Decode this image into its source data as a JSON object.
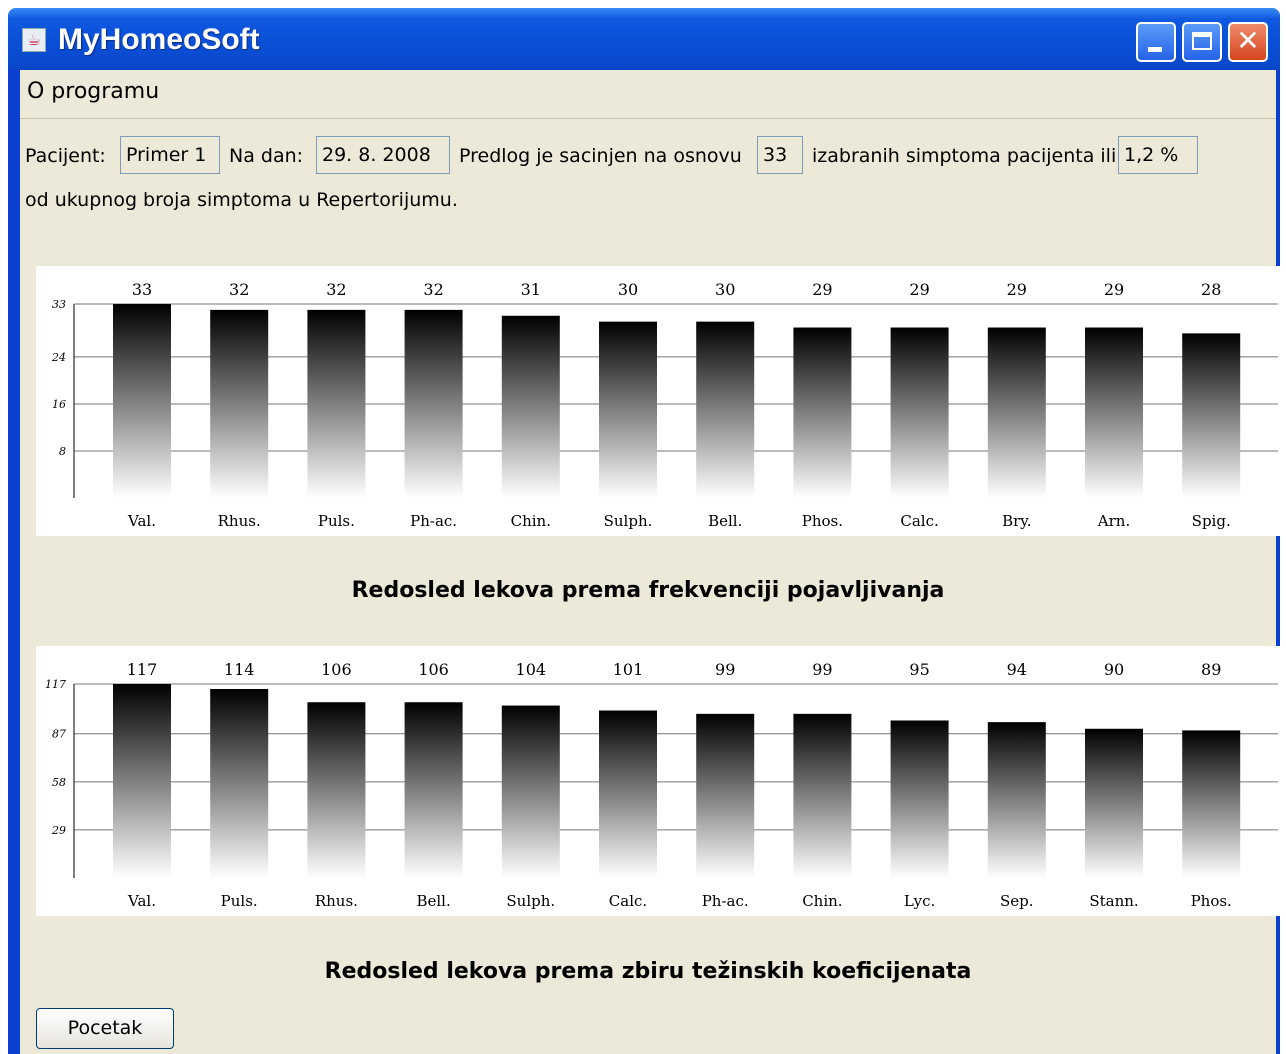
{
  "window": {
    "title": "MyHomeoSoft"
  },
  "menu": {
    "about": "O programu"
  },
  "info": {
    "patient_label": "Pacijent:",
    "patient_value": "Primer 1",
    "date_label": "Na dan:",
    "date_value": "29. 8. 2008",
    "basis_label": "Predlog je sacinjen na osnovu",
    "count_value": "33",
    "selected_label": "izabranih simptoma pacijenta ili",
    "percent_value": "1,2 %",
    "line2": "od ukupnog broja simptoma u Repertorijumu."
  },
  "buttons": {
    "start": "Pocetak"
  },
  "chart_data": [
    {
      "type": "bar",
      "title": "Redosled lekova prema frekvenciji pojavljivanja",
      "categories": [
        "Val.",
        "Rhus.",
        "Puls.",
        "Ph-ac.",
        "Chin.",
        "Sulph.",
        "Bell.",
        "Phos.",
        "Calc.",
        "Bry.",
        "Arn.",
        "Spig."
      ],
      "values": [
        33,
        32,
        32,
        32,
        31,
        30,
        30,
        29,
        29,
        29,
        29,
        28
      ],
      "yticks": [
        8,
        16,
        24,
        33
      ],
      "ylim": [
        0,
        33
      ],
      "grid": true
    },
    {
      "type": "bar",
      "title": "Redosled lekova prema zbiru težinskih koeficijenata",
      "categories": [
        "Val.",
        "Puls.",
        "Rhus.",
        "Bell.",
        "Sulph.",
        "Calc.",
        "Ph-ac.",
        "Chin.",
        "Lyc.",
        "Sep.",
        "Stann.",
        "Phos."
      ],
      "values": [
        117,
        114,
        106,
        106,
        104,
        101,
        99,
        99,
        95,
        94,
        90,
        89
      ],
      "yticks": [
        29,
        58,
        87,
        117
      ],
      "ylim": [
        0,
        117
      ],
      "grid": true
    }
  ]
}
